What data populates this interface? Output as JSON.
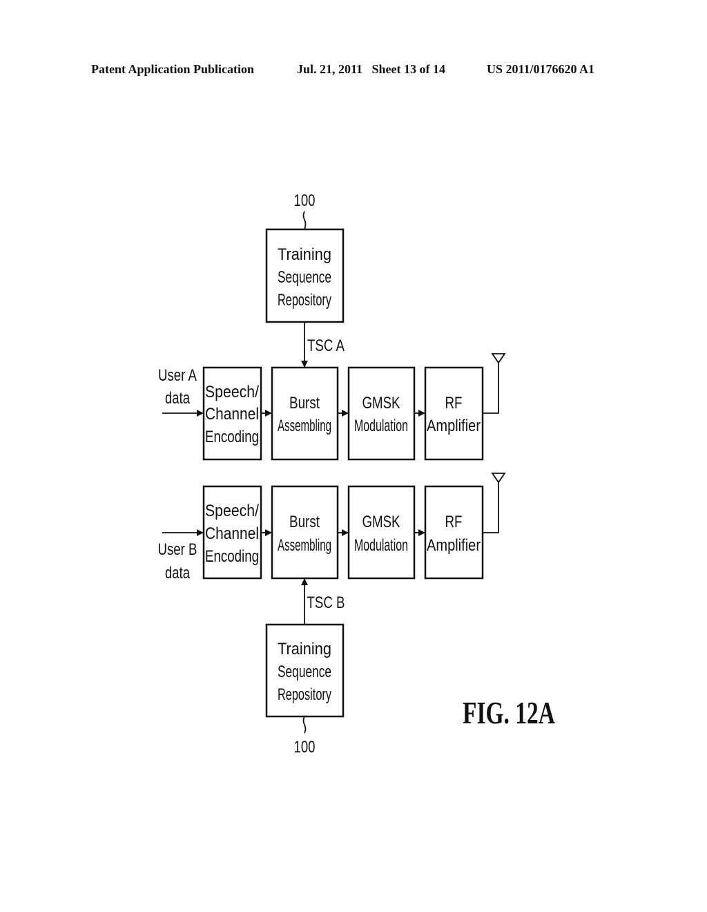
{
  "header": {
    "publication": "Patent Application Publication",
    "date_sheet": "Jul. 21, 2011   Sheet 13 of 14",
    "patent_number": "US 2011/0176620 A1"
  },
  "figure_label": "FIG. 12A",
  "top_repository": {
    "ref": "100",
    "lines": [
      "Training",
      "Sequence",
      "Repository"
    ],
    "signal": "TSC A"
  },
  "bottom_repository": {
    "ref": "100",
    "lines": [
      "Training",
      "Sequence",
      "Repository"
    ],
    "signal": "TSC B"
  },
  "chain_a": {
    "input": [
      "User A",
      "data"
    ],
    "blocks": [
      {
        "lines": [
          "Speech/",
          "Channel",
          "Encoding"
        ]
      },
      {
        "lines": [
          "Burst",
          "Assembling"
        ]
      },
      {
        "lines": [
          "GMSK",
          "Modulation"
        ]
      },
      {
        "lines": [
          "RF",
          "Amplifier"
        ]
      }
    ],
    "output": "antenna"
  },
  "chain_b": {
    "input": [
      "User B",
      "data"
    ],
    "blocks": [
      {
        "lines": [
          "Speech/",
          "Channel",
          "Encoding"
        ]
      },
      {
        "lines": [
          "Burst",
          "Assembling"
        ]
      },
      {
        "lines": [
          "GMSK",
          "Modulation"
        ]
      },
      {
        "lines": [
          "RF",
          "Amplifier"
        ]
      }
    ],
    "output": "antenna"
  }
}
